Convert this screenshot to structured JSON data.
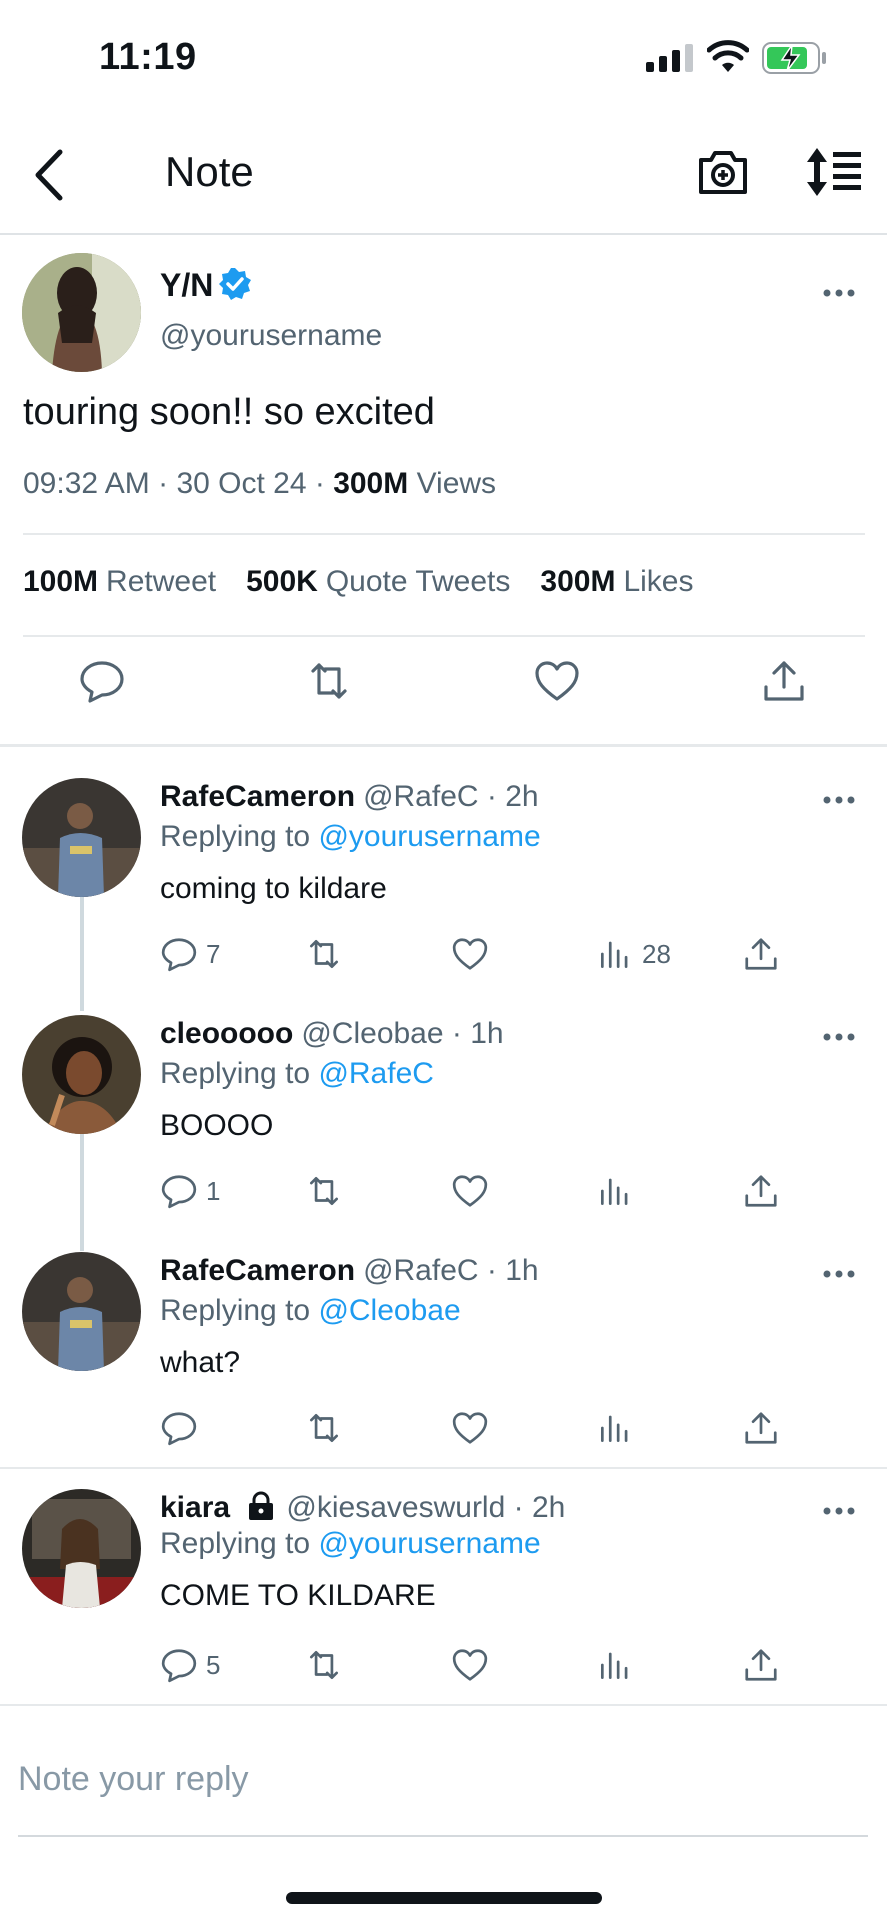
{
  "status": {
    "time": "11:19"
  },
  "nav": {
    "title": "Note"
  },
  "main_tweet": {
    "name": "Y/N",
    "handle": "@yourusername",
    "text": "touring soon!! so excited",
    "time": "09:32 AM",
    "date": "30 Oct 24",
    "views_count": "300M",
    "views_label": "Views",
    "retweets_count": "100M",
    "retweets_label": "Retweet",
    "quotes_count": "500K",
    "quotes_label": "Quote Tweets",
    "likes_count": "300M",
    "likes_label": "Likes"
  },
  "replies": [
    {
      "name": "RafeCameron",
      "handle": "@RafeC",
      "time": "· 2h",
      "replying_prefix": "Replying to",
      "replying_to": "@yourusername",
      "text": "coming to kildare",
      "reply_count": "7",
      "view_count": "28"
    },
    {
      "name": "cleooooo",
      "handle": "@Cleobae",
      "time": "· 1h",
      "replying_prefix": "Replying to",
      "replying_to": "@RafeC",
      "text": "BOOOO",
      "reply_count": "1",
      "view_count": ""
    },
    {
      "name": "RafeCameron",
      "handle": "@RafeC",
      "time": "· 1h",
      "replying_prefix": "Replying to",
      "replying_to": "@Cleobae",
      "text": "what?",
      "reply_count": "",
      "view_count": ""
    },
    {
      "name": "kiara",
      "handle": "@kiesaveswurld",
      "time": "· 2h",
      "replying_prefix": "Replying to",
      "replying_to": "@yourusername",
      "text": "COME TO KILDARE",
      "reply_count": "5",
      "view_count": ""
    }
  ],
  "reply_box": {
    "placeholder": "Note your reply"
  },
  "colors": {
    "accent": "#1d9bf0",
    "text": "#0f1419",
    "muted": "#536471"
  }
}
